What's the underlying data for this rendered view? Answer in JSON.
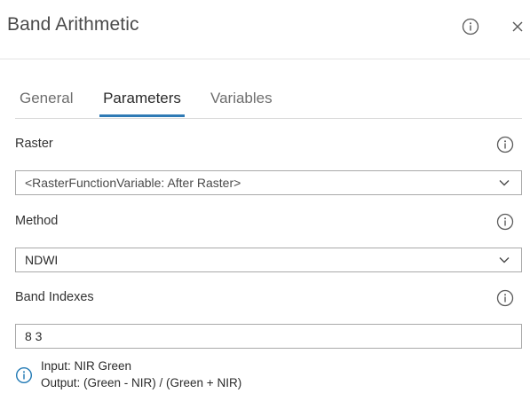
{
  "panel": {
    "title": "Band Arithmetic"
  },
  "tabs": [
    {
      "label": "General",
      "active": false
    },
    {
      "label": "Parameters",
      "active": true
    },
    {
      "label": "Variables",
      "active": false
    }
  ],
  "fields": {
    "raster": {
      "label": "Raster",
      "value": "<RasterFunctionVariable: After Raster>"
    },
    "method": {
      "label": "Method",
      "value": "NDWI"
    },
    "band_indexes": {
      "label": "Band Indexes",
      "value": "8 3"
    }
  },
  "hint": {
    "input_line": "Input: NIR Green",
    "output_line": "Output: (Green - NIR) / (Green + NIR)"
  },
  "colors": {
    "accent": "#2f7ab5",
    "info_icon_blue": "#1f78b4",
    "border": "#a9a9a9"
  },
  "icons": {
    "header_info": "info-circle-icon",
    "close": "close-icon",
    "field_info": "info-circle-icon",
    "select_arrow": "chevron-down-icon",
    "hint": "info-circle-icon"
  }
}
